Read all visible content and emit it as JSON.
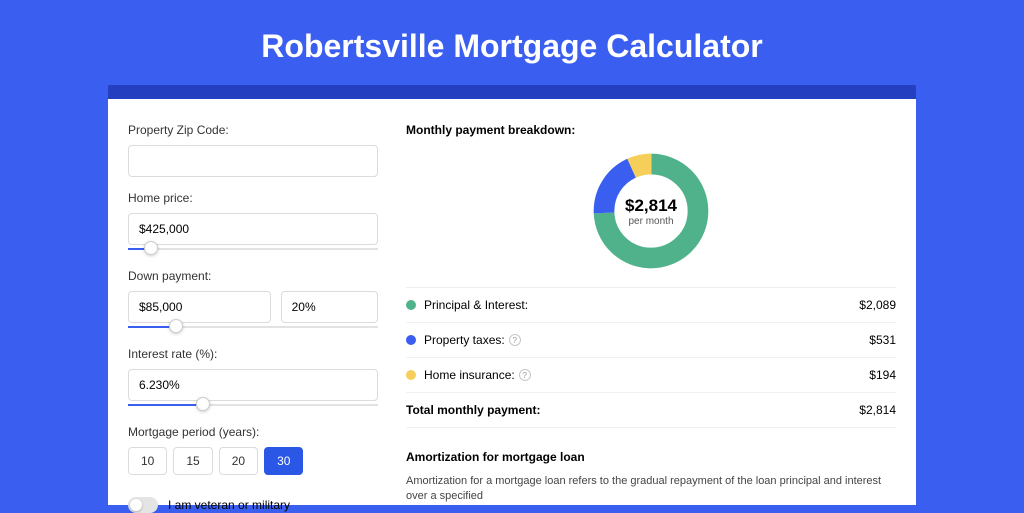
{
  "title": "Robertsville Mortgage Calculator",
  "form": {
    "zip_label": "Property Zip Code:",
    "zip_value": "",
    "home_price_label": "Home price:",
    "home_price_value": "$425,000",
    "down_payment_label": "Down payment:",
    "down_payment_amount": "$85,000",
    "down_payment_percent": "20%",
    "interest_label": "Interest rate (%):",
    "interest_value": "6.230%",
    "period_label": "Mortgage period (years):",
    "period_options": [
      "10",
      "15",
      "20",
      "30"
    ],
    "period_selected": "30",
    "veteran_label": "I am veteran or military",
    "sliders": {
      "home_price_pct": 9,
      "down_payment_pct": 19,
      "interest_pct": 30
    }
  },
  "breakdown": {
    "title": "Monthly payment breakdown:",
    "center_amount": "$2,814",
    "center_sub": "per month",
    "items": [
      {
        "label": "Principal & Interest:",
        "value": "$2,089",
        "color": "#4fb28b",
        "info": false
      },
      {
        "label": "Property taxes:",
        "value": "$531",
        "color": "#3a5ef0",
        "info": true
      },
      {
        "label": "Home insurance:",
        "value": "$194",
        "color": "#f6cf5a",
        "info": true
      }
    ],
    "total_label": "Total monthly payment:",
    "total_value": "$2,814"
  },
  "amortization": {
    "title": "Amortization for mortgage loan",
    "text": "Amortization for a mortgage loan refers to the gradual repayment of the loan principal and interest over a specified"
  },
  "chart_data": {
    "type": "pie",
    "title": "Monthly payment breakdown",
    "series": [
      {
        "name": "Principal & Interest",
        "value": 2089,
        "color": "#4fb28b"
      },
      {
        "name": "Property taxes",
        "value": 531,
        "color": "#3a5ef0"
      },
      {
        "name": "Home insurance",
        "value": 194,
        "color": "#f6cf5a"
      }
    ],
    "total": 2814,
    "center_label": "$2,814 per month"
  }
}
